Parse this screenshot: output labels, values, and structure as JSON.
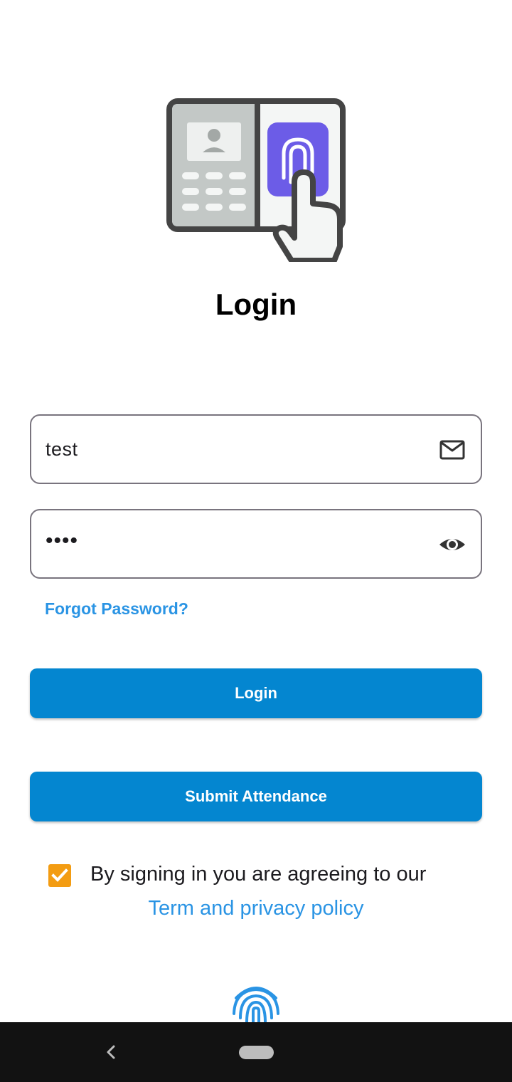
{
  "screen": {
    "title": "Login",
    "email": {
      "value": "test",
      "icon": "mail-icon"
    },
    "password": {
      "value": "••••",
      "icon": "eye-icon"
    },
    "forgot_label": "Forgot Password?",
    "login_button": "Login",
    "attendance_button": "Submit Attendance",
    "terms": {
      "checked": true,
      "text": "By signing in you are agreeing to our",
      "link": "Term and privacy policy"
    }
  },
  "colors": {
    "primary": "#0486d0",
    "link": "#2a94e4",
    "checkbox": "#f39c12",
    "fingerprint_accent": "#6c5ce7"
  }
}
